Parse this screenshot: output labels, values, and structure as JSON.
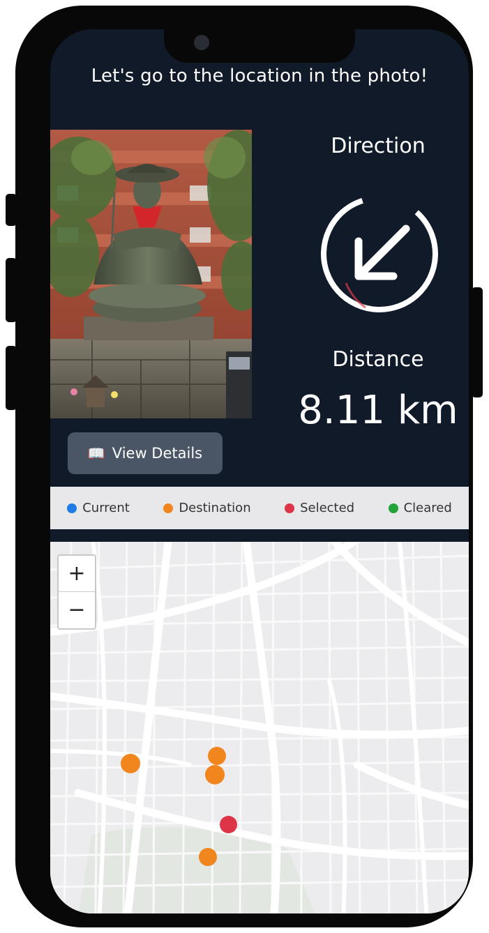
{
  "header": {
    "title": "Let's go to the location in the photo!"
  },
  "photo": {
    "alt": "Stone seated Jizo statue with red bib in front of brick building"
  },
  "details_button": {
    "icon": "book-icon",
    "label": "View Details"
  },
  "direction": {
    "label": "Direction",
    "arrow": "arrow-down-left-icon"
  },
  "distance": {
    "label": "Distance",
    "value": "8.11 km"
  },
  "legend": {
    "items": [
      {
        "label": "Current",
        "color": "#1e7be8"
      },
      {
        "label": "Destination",
        "color": "#f2861e"
      },
      {
        "label": "Selected",
        "color": "#dd3448"
      },
      {
        "label": "Cleared",
        "color": "#23a33a"
      }
    ]
  },
  "map": {
    "zoom_in": "+",
    "zoom_out": "−",
    "markers": [
      {
        "type": "Destination",
        "color": "#f2861e"
      },
      {
        "type": "Destination",
        "color": "#f2861e"
      },
      {
        "type": "Destination",
        "color": "#f2861e"
      },
      {
        "type": "Destination",
        "color": "#f2861e"
      },
      {
        "type": "Selected",
        "color": "#dd3448"
      }
    ]
  }
}
